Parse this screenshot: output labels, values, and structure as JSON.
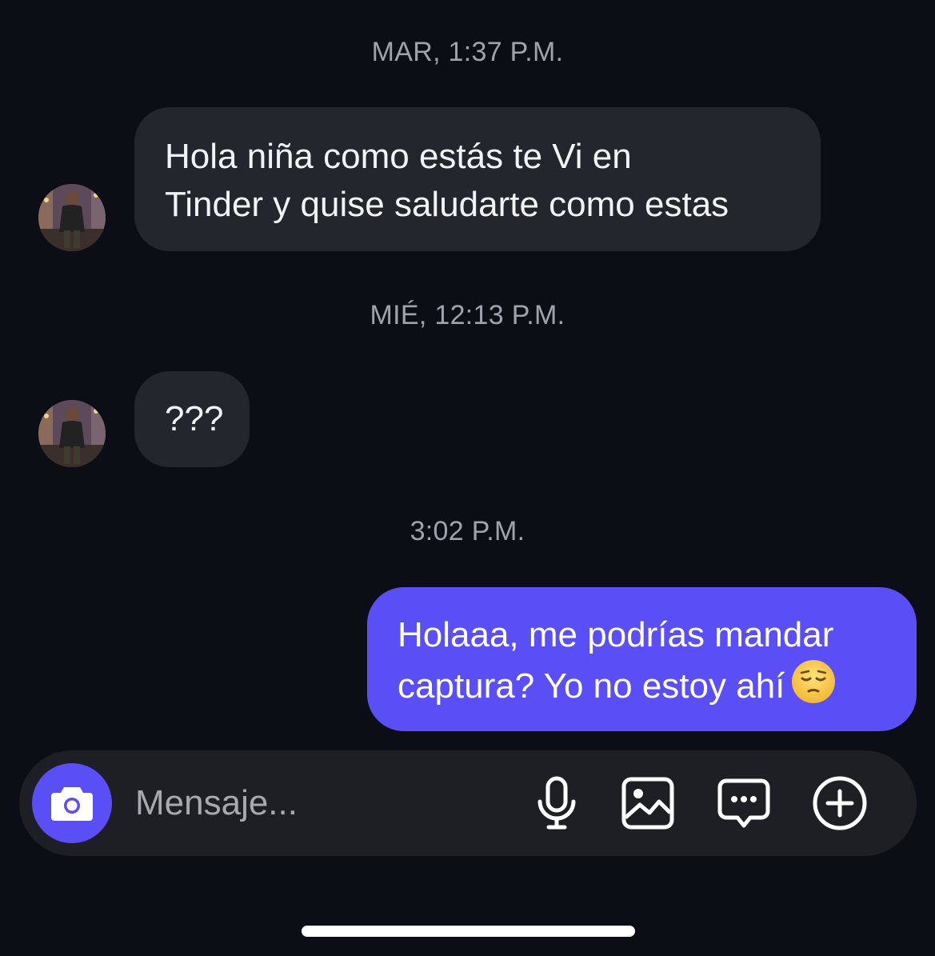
{
  "conversation": {
    "timestamps": [
      "MAR, 1:37 P.M.",
      "MIÉ, 12:13 P.M.",
      "3:02 P.M."
    ],
    "messages": [
      {
        "direction": "incoming",
        "lines": [
          "Hola niña como estás te Vi en",
          "Tinder y quise saludarte como estas"
        ]
      },
      {
        "direction": "incoming",
        "lines": [
          "???"
        ]
      },
      {
        "direction": "outgoing",
        "lines": [
          "Holaaa, me podrías mandar",
          "captura? Yo no estoy ahí"
        ],
        "emoji": "pensive-face"
      }
    ]
  },
  "composer": {
    "placeholder": "Mensaje...",
    "icons": [
      "camera-icon",
      "microphone-icon",
      "image-icon",
      "chat-bubble-icon",
      "plus-circle-icon"
    ]
  },
  "colors": {
    "background": "#0b0e14",
    "incoming_bubble": "#23262c",
    "outgoing_bubble": "#5a4ef6",
    "accent": "#5a4ef6"
  }
}
